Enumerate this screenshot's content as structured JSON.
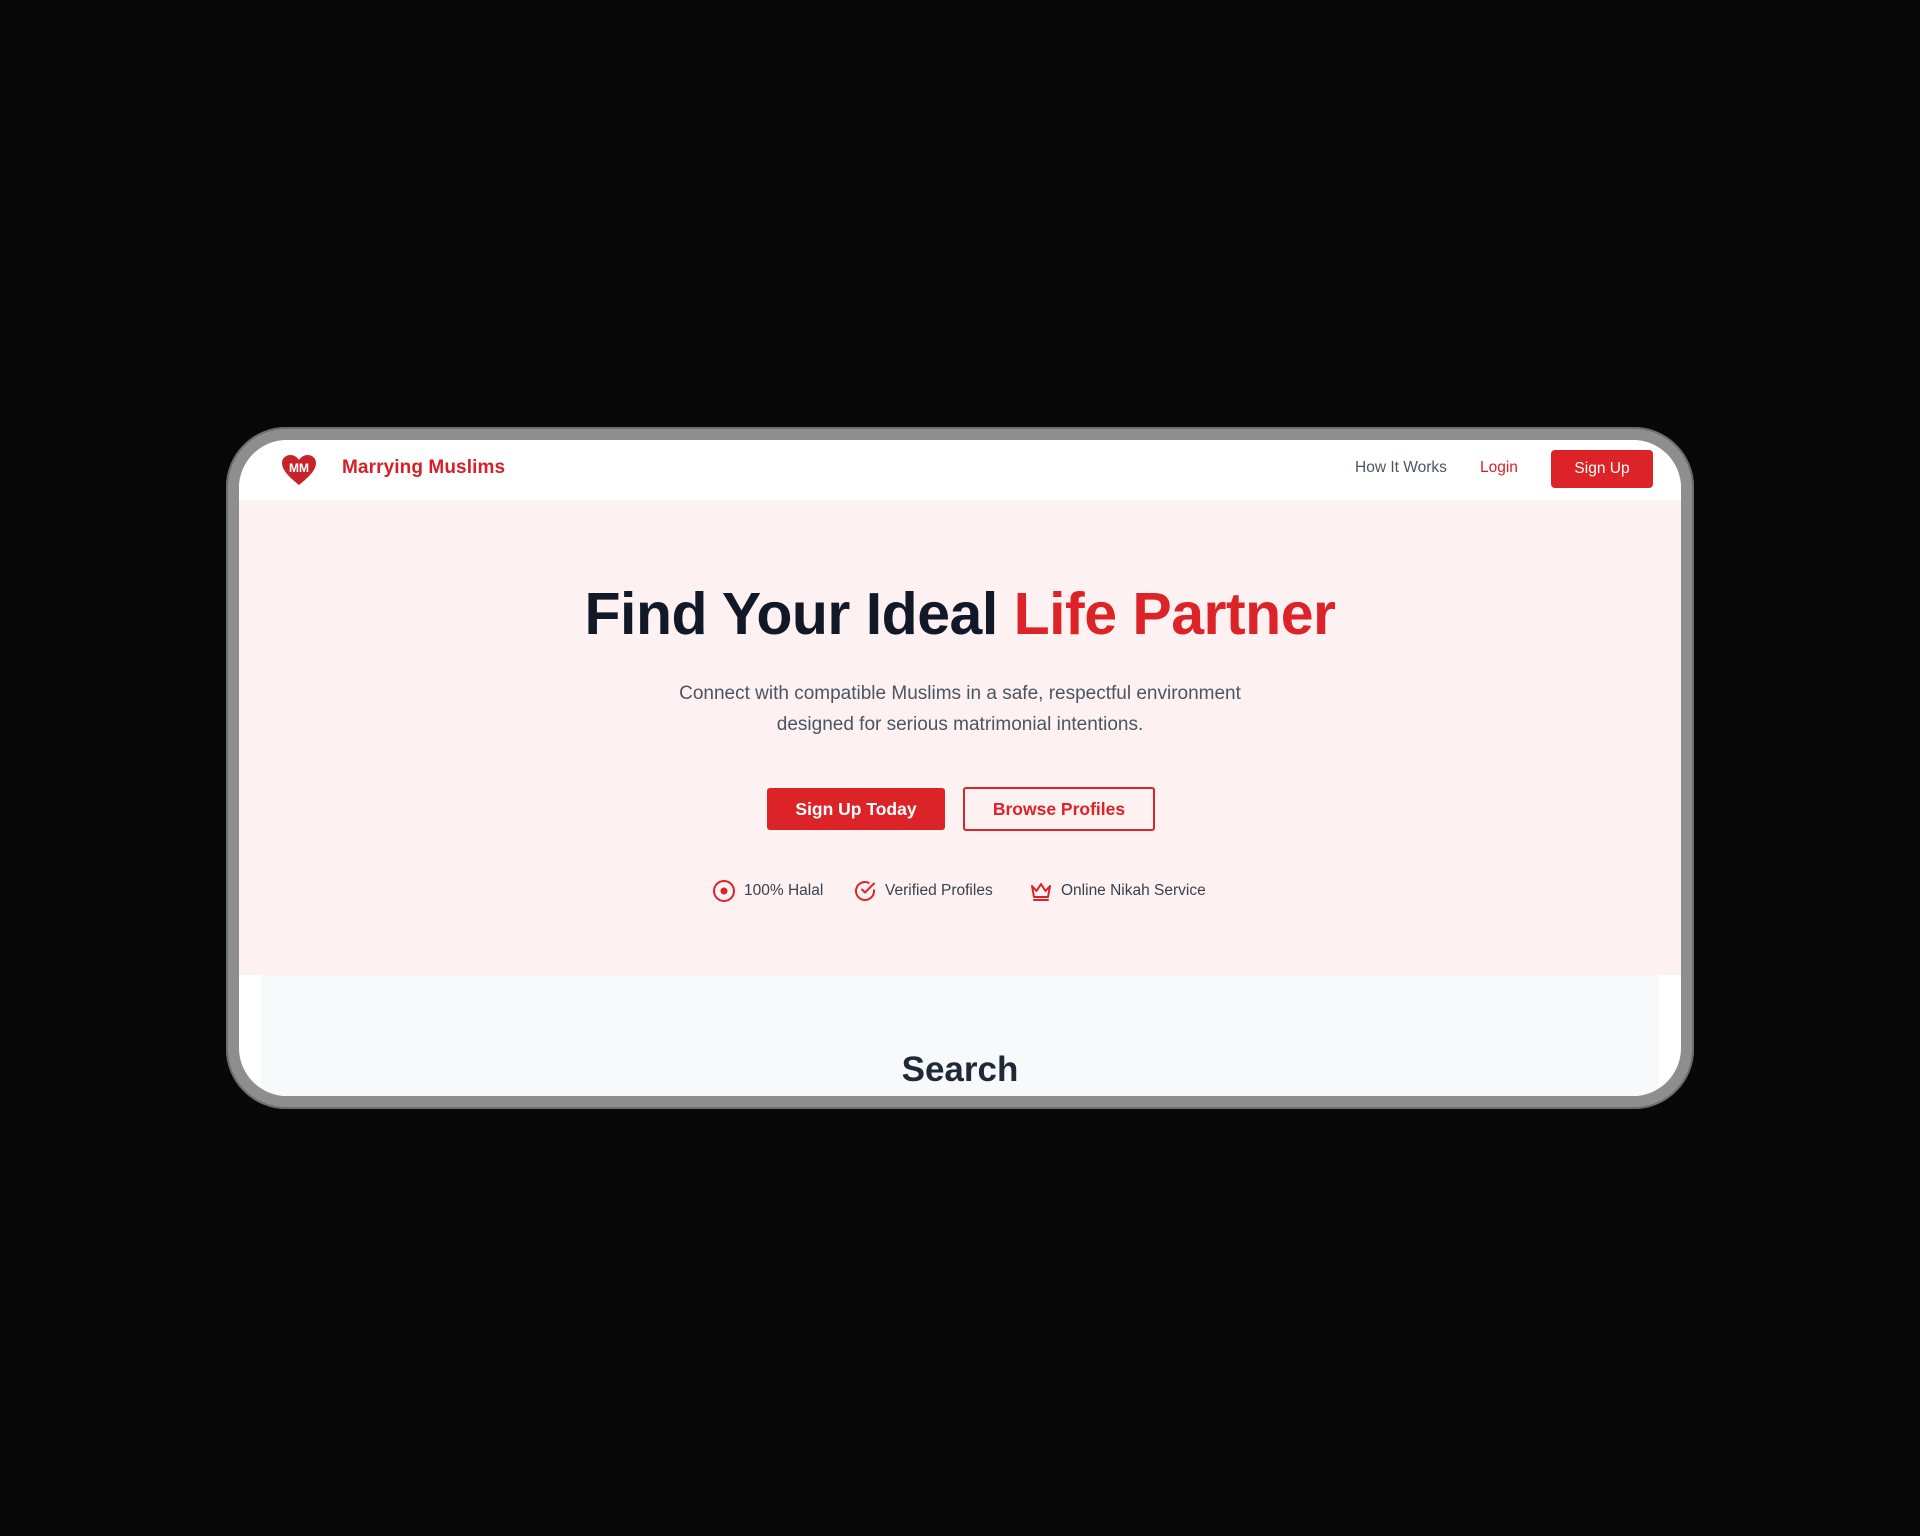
{
  "brand": {
    "name": "Marrying Muslims",
    "logo_icon": "heart-mm-logo",
    "accent_color": "#dc2327"
  },
  "nav": {
    "how_it_works": "How It Works",
    "login": "Login",
    "sign_up": "Sign Up"
  },
  "hero": {
    "headline_main": "Find Your Ideal ",
    "headline_accent": "Life Partner",
    "subtext_line1": "Connect with compatible Muslims in a safe, respectful environment",
    "subtext_line2": "designed for serious matrimonial intentions.",
    "primary_cta": "Sign Up Today",
    "secondary_cta": "Browse Profiles",
    "badges": [
      {
        "icon": "target-circle-icon",
        "label": "100% Halal"
      },
      {
        "icon": "check-circle-icon",
        "label": "Verified Profiles"
      },
      {
        "icon": "crown-icon",
        "label": "Online Nikah Service"
      }
    ]
  },
  "search": {
    "heading": "Search"
  }
}
